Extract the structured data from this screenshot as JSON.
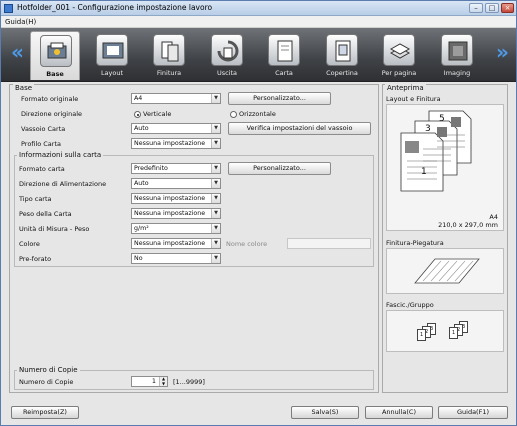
{
  "window": {
    "title": "Hotfolder_001 - Configurazione impostazione lavoro"
  },
  "menu": {
    "help": "Guida(H)"
  },
  "tabs": [
    {
      "label": "Base",
      "icon": "base-icon",
      "active": true
    },
    {
      "label": "Layout",
      "icon": "layout-icon"
    },
    {
      "label": "Finitura",
      "icon": "finishing-icon"
    },
    {
      "label": "Uscita",
      "icon": "output-icon"
    },
    {
      "label": "Carta",
      "icon": "paper-icon"
    },
    {
      "label": "Copertina",
      "icon": "cover-icon"
    },
    {
      "label": "Per pagina",
      "icon": "per-page-icon"
    },
    {
      "label": "Imaging",
      "icon": "imaging-icon"
    }
  ],
  "nav": {
    "prev": "«",
    "next": "»"
  },
  "base": {
    "title": "Base",
    "original_format_label": "Formato originale",
    "original_format_value": "A4",
    "custom_button": "Personalizzato...",
    "direction_label": "Direzione originale",
    "direction_vertical": "Verticale",
    "direction_horizontal": "Orizzontale",
    "tray_label": "Vassoio Carta",
    "tray_value": "Auto",
    "verify_tray_button": "Verifica impostazioni del vassoio",
    "profile_label": "Profilo Carta",
    "profile_value": "Nessuna impostazione"
  },
  "paper_info": {
    "title": "Informazioni sulla carta",
    "format_label": "Formato carta",
    "format_value": "Predefinito",
    "custom_button": "Personalizzato...",
    "feed_label": "Direzione di Alimentazione",
    "feed_value": "Auto",
    "type_label": "Tipo carta",
    "type_value": "Nessuna impostazione",
    "weight_label": "Peso della Carta",
    "weight_value": "Nessuna impostazione",
    "unit_label": "Unità di Misura - Peso",
    "unit_value": "g/m²",
    "color_label": "Colore",
    "color_value": "Nessuna impostazione",
    "color_name_label": "Nome colore",
    "color_name_value": "",
    "prepunched_label": "Pre-forato",
    "prepunched_value": "No"
  },
  "copies": {
    "title": "Numero di Copie",
    "label": "Numero di Copie",
    "value": "1",
    "range": "[1...9999]"
  },
  "preview": {
    "title": "Anteprima",
    "layout_title": "Layout e Finitura",
    "page_numbers": [
      "5",
      "3",
      "1"
    ],
    "paper_size": "A4",
    "paper_dims": "210,0 x 297,0 mm",
    "folding_title": "Finitura-Piegatura",
    "group_title": "Fascic./Gruppo",
    "group_set_a": [
      "1",
      "2",
      "3"
    ],
    "group_set_b": [
      "1",
      "2",
      "3"
    ]
  },
  "buttons": {
    "reset": "Reimposta(Z)",
    "save": "Salva(S)",
    "cancel": "Annulla(C)",
    "help": "Guida(F1)"
  },
  "colors": {
    "accent": "#4d9be8",
    "toolbar": "#3f4246",
    "window_bg": "#e6e6e6"
  }
}
